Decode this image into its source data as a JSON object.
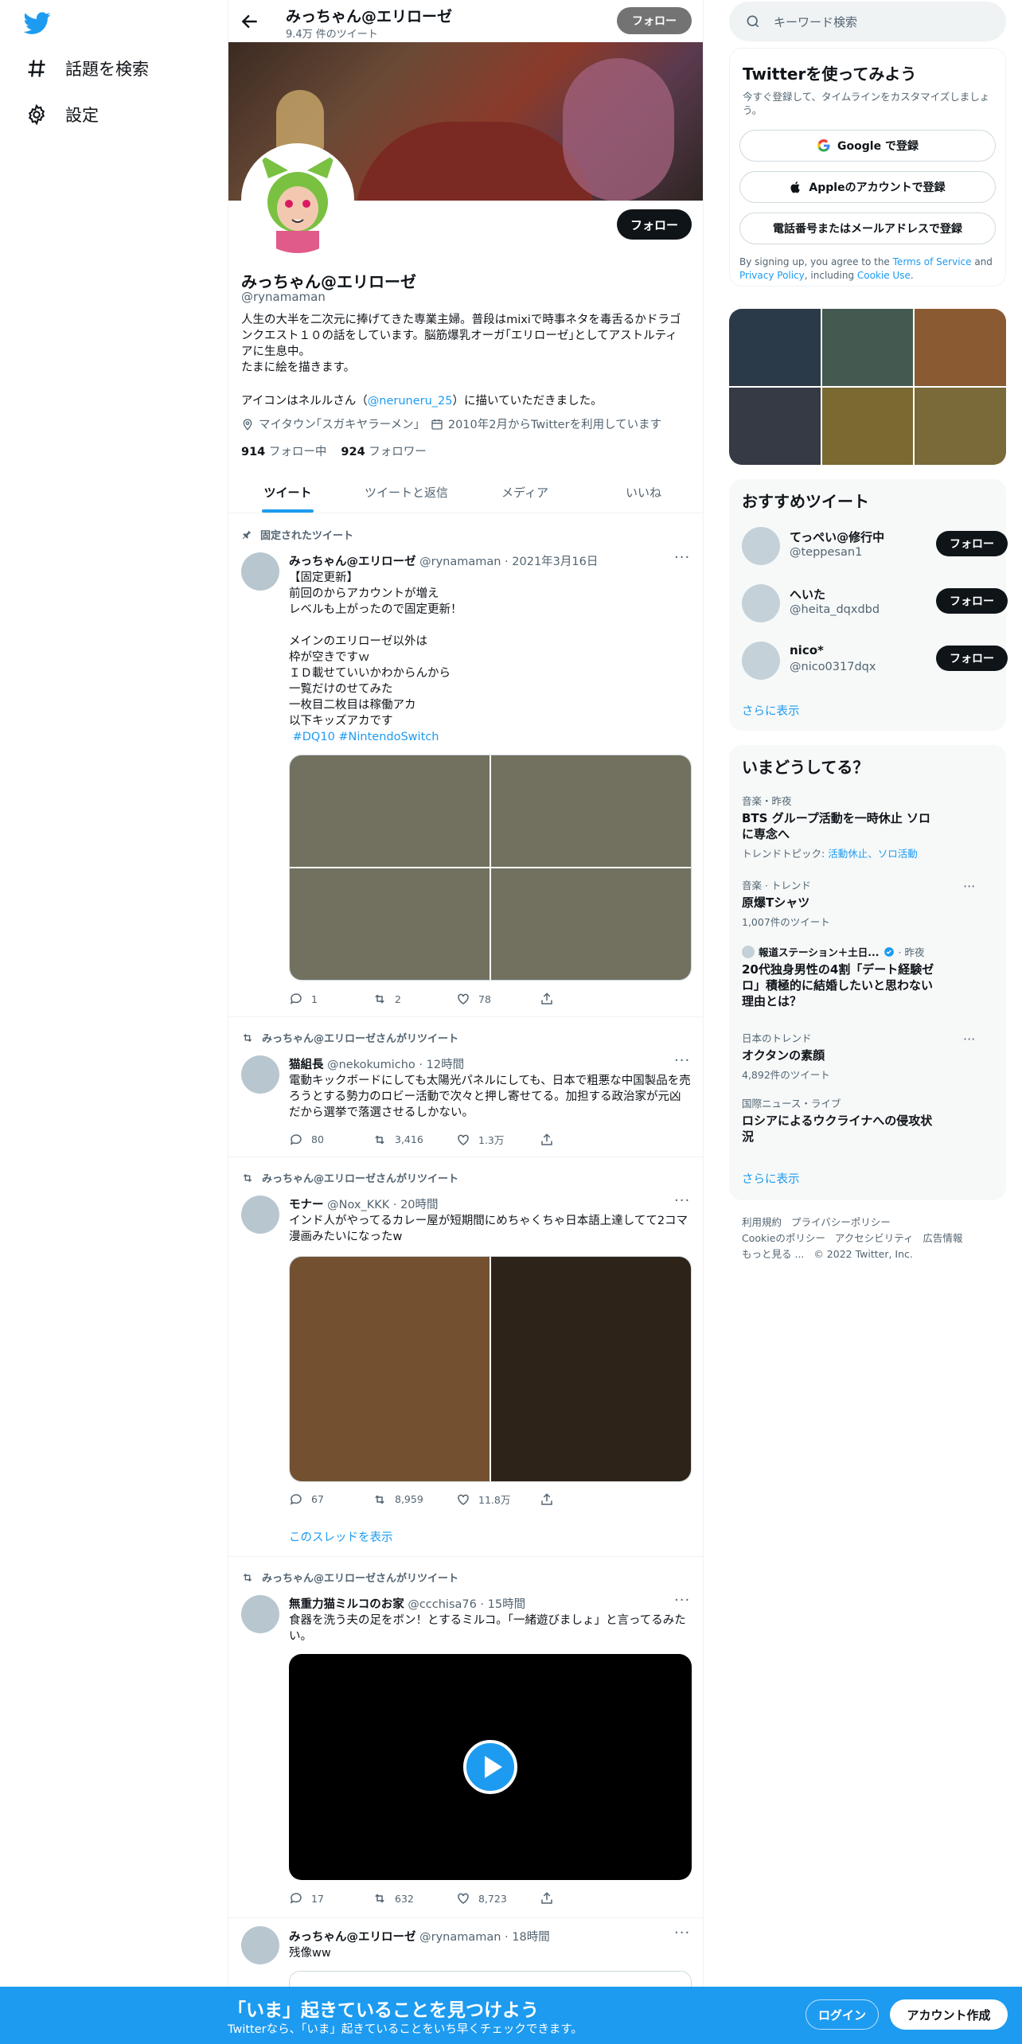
{
  "colors": {
    "accent": "#1d9bf0",
    "text": "#0f1419",
    "muted": "#536471",
    "follow_bg": "#0f1419"
  },
  "nav": {
    "logo_icon": "twitter-bird-icon",
    "items": [
      {
        "label": "話題を検索",
        "icon": "hashtag-icon"
      },
      {
        "label": "設定",
        "icon": "gear-icon"
      }
    ]
  },
  "header": {
    "name": "みっちゃん@エリローゼ",
    "tweet_count": "9.4万 件のツイート",
    "follow_label": "フォロー"
  },
  "profile": {
    "follow_label": "フォロー",
    "name": "みっちゃん@エリローゼ",
    "handle": "@rynamaman",
    "bio": "人生の大半を二次元に捧げてきた専業主婦。普段はmixiで時事ネタを毒舌るかドラゴンクエスト１０の話をしています。脳筋爆乳オーガ｢エリローゼ｣としてアストルティアに生息中。\nたまに絵を描きます。",
    "bio_line2_prefix": "アイコンはネルルさん（",
    "bio_link": "@neruneru_25",
    "bio_line2_suffix": "）に描いていただきました。",
    "location": "マイタウン｢スガキヤラーメン｣",
    "joined": "2010年2月からTwitterを利用しています",
    "following_count": "914",
    "following_label": "フォロー中",
    "followers_count": "924",
    "followers_label": "フォロワー"
  },
  "tabs": [
    "ツイート",
    "ツイートと返信",
    "メディア",
    "いいね"
  ],
  "tweets": [
    {
      "context": "固定されたツイート",
      "name": "みっちゃん@エリローゼ",
      "meta": "@rynamaman · 2021年3月16日",
      "text": "【固定更新】\n前回のからアカウントが増え\nレベルも上がったので固定更新！\n\nメインのエリローゼ以外は\n枠が空きですｗ\nＩＤ載せていいかわからんから\n一覧だけのせてみた\n一枚目二枚目は稼働アカ\n以下キッズアカです",
      "hashtags": " #DQ10 #NintendoSwitch",
      "replies": "1",
      "retweets": "2",
      "likes": "78"
    },
    {
      "context": "みっちゃん@エリローゼさんがリツイート",
      "name": "猫組長",
      "meta": "@nekokumicho · 12時間",
      "text": "電動キックボードにしても太陽光パネルにしても、日本で粗悪な中国製品を売ろうとする勢力のロビー活動で次々と押し寄せてる。加担する政治家が元凶だから選挙で落選させるしかない。",
      "replies": "80",
      "retweets": "3,416",
      "likes": "1.3万"
    },
    {
      "context": "みっちゃん@エリローゼさんがリツイート",
      "name": "モナー",
      "meta": "@Nox_KKK · 20時間",
      "text": "インド人がやってるカレー屋が短期間にめちゃくちゃ日本語上達してて2コマ漫画みたいになったw",
      "replies": "67",
      "retweets": "8,959",
      "likes": "11.8万",
      "thread_link": "このスレッドを表示"
    },
    {
      "context": "みっちゃん@エリローゼさんがリツイート",
      "name": "無重力猫ミルコのお家",
      "meta": "@ccchisa76 · 15時間",
      "text": "食器を洗う夫の足をボン！とするミルコ。「一緒遊びましょ」と言ってるみたい。",
      "replies": "17",
      "retweets": "632",
      "likes": "8,723"
    },
    {
      "name": "みっちゃん@エリローゼ",
      "meta": "@rynamaman · 18時間",
      "text": "残像ww"
    }
  ],
  "sidebar": {
    "search_placeholder": "キーワード検索",
    "signup": {
      "title": "Twitterを使ってみよう",
      "subtitle": "今すぐ登録して、タイムラインをカスタマイズしましょう。",
      "google": "Google で登録",
      "apple": "Appleのアカウントで登録",
      "phone": "電話番号またはメールアドレスで登録",
      "legal_1": "By signing up, you agree to the ",
      "legal_terms": "Terms of Service",
      "legal_2": " and ",
      "legal_privacy": "Privacy Policy",
      "legal_3": ", including ",
      "legal_cookie": "Cookie Use",
      "legal_4": "."
    },
    "recommend_title": "おすすめツイート",
    "recommend": [
      {
        "name": "てっぺい@修行中",
        "handle": "@teppesan1",
        "follow": "フォロー"
      },
      {
        "name": "へいた",
        "handle": "@heita_dqxdbd",
        "follow": "フォロー"
      },
      {
        "name": "nico*",
        "handle": "@nico0317dqx",
        "follow": "フォロー"
      }
    ],
    "show_more": "さらに表示",
    "trends_title": "いまどうしてる？",
    "trends": [
      {
        "category": "音楽・昨夜",
        "title": "BTS グループ活動を一時休止 ソロに専念へ",
        "topic_prefix": "トレンドトピック: ",
        "topic_links": "活動休止、ソロ活動"
      },
      {
        "category": "音楽 · トレンド",
        "title": "原爆Tシャツ",
        "sub": "1,007件のツイート"
      },
      {
        "source": "報道ステーション＋土日...",
        "time": "· 昨夜",
        "title": "20代独身男性の4割「デート経験ゼロ」積極的に結婚したいと思わない理由とは？"
      },
      {
        "category": "日本のトレンド",
        "title": "オクタンの素顔",
        "sub": "4,892件のツイート"
      },
      {
        "category": "国際ニュース・ライブ",
        "title": "ロシアによるウクライナへの侵攻状況"
      }
    ],
    "trends_more": "さらに表示",
    "footer": [
      "利用規約",
      "プライバシーポリシー",
      "Cookieのポリシー",
      "アクセシビリティ",
      "広告情報",
      "もっと見る ...",
      "© 2022 Twitter, Inc."
    ]
  },
  "bottom_bar": {
    "title": "「いま」起きていることを見つけよう",
    "subtitle": "Twitterなら、「いま」起きていることをいち早くチェックできます。",
    "login": "ログイン",
    "signup": "アカウント作成"
  }
}
